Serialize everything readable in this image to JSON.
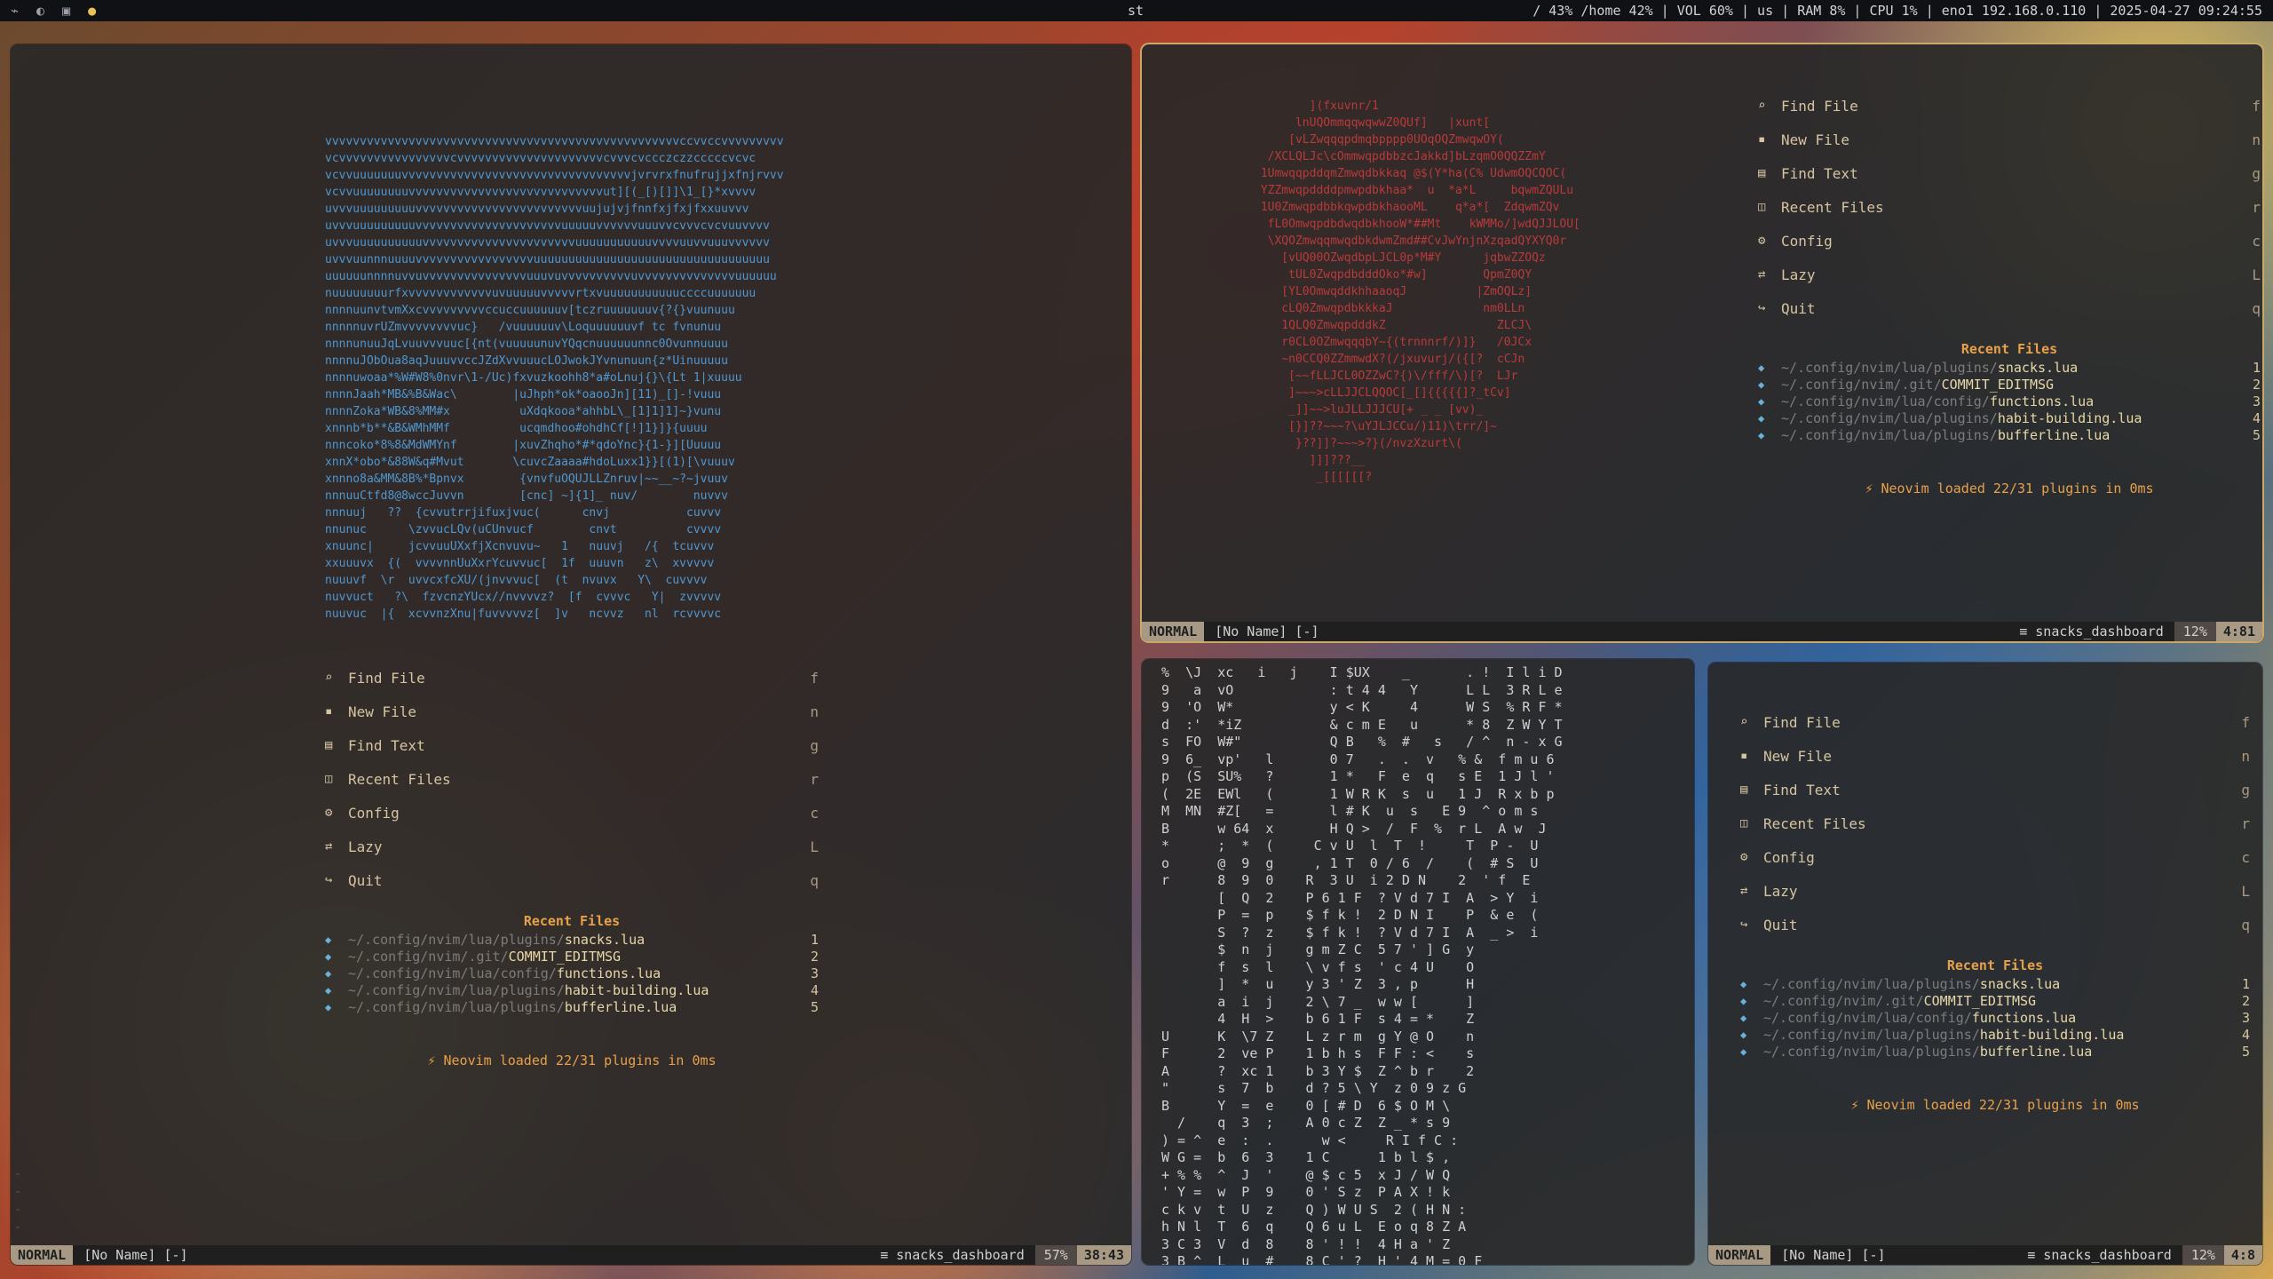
{
  "topbar": {
    "workspaces": [
      "⌁",
      "◐",
      "▣",
      "●"
    ],
    "window_title": "st",
    "status": "/ 43%  /home 42% | VOL 60% | us | RAM  8% | CPU  1% | eno1 192.168.0.110 | 2025-04-27 09:24:55"
  },
  "dashboard": {
    "menu": [
      {
        "icon": "search-icon",
        "glyph": "⌕",
        "label": "Find File",
        "key": "f"
      },
      {
        "icon": "new-file-icon",
        "glyph": "▪",
        "label": "New File",
        "key": "n"
      },
      {
        "icon": "text-icon",
        "glyph": "▤",
        "label": "Find Text",
        "key": "g"
      },
      {
        "icon": "recent-icon",
        "glyph": "◫",
        "label": "Recent Files",
        "key": "r"
      },
      {
        "icon": "gear-icon",
        "glyph": "⚙",
        "label": "Config",
        "key": "c"
      },
      {
        "icon": "lazy-icon",
        "glyph": "⇄",
        "label": "Lazy",
        "key": "L"
      },
      {
        "icon": "quit-icon",
        "glyph": "↪",
        "label": "Quit",
        "key": "q"
      }
    ],
    "recent_title": "Recent Files",
    "recent": [
      {
        "dir": "~/.config/nvim/lua/plugins/",
        "file": "snacks.lua",
        "num": "1"
      },
      {
        "dir": "~/.config/nvim/.git/",
        "file": "COMMIT_EDITMSG",
        "num": "2"
      },
      {
        "dir": "~/.config/nvim/lua/config/",
        "file": "functions.lua",
        "num": "3"
      },
      {
        "dir": "~/.config/nvim/lua/plugins/",
        "file": "habit-building.lua",
        "num": "4"
      },
      {
        "dir": "~/.config/nvim/lua/plugins/",
        "file": "bufferline.lua",
        "num": "5"
      }
    ],
    "loaded": "⚡ Neovim loaded 22/31 plugins in 0ms"
  },
  "panes": {
    "left": {
      "mode": "NORMAL",
      "name": "[No Name] [-]",
      "filetype": "≡ snacks_dashboard",
      "percent": "57%",
      "pos": "38:43"
    },
    "top_right": {
      "mode": "NORMAL",
      "name": "[No Name] [-]",
      "filetype": "≡ snacks_dashboard",
      "percent": "12%",
      "pos": "4:81"
    },
    "bottom_right": {
      "mode": "NORMAL",
      "name": "[No Name] [-]",
      "filetype": "≡ snacks_dashboard",
      "percent": "12%",
      "pos": "4:8"
    }
  },
  "art_left": "vvvvvvvvvvvvvvvvvvvvvvvvvvvvvvvvvvvvvvvvvvvvvvvvvvvccvvccvvvvvvvvv\nvcvvvvvvvvvvvvvvvvcvvvvvvvvvvvvvvvvvvvvvcvvvcvccczczzcccccvcvc\nvcvvuuuuuuuvvvvvvvvvvvvvvvvvvvvvvvvvvvvvvvvvjvrvrxfnufrujjxfnjrvvv\nvcvvuuuuuuuuvvvvvvvvvvvvvvvvvvvvvvvvvvvvut][(_[)[]]\\1_[}*xvvvv\nuvvvuuuuuuuuuvvvvvvvvvvvvvvvvvvvvvvvvuujujvjfnnfxjfxjfxxuuvvv\nuvvvuuuuuuuuuvvvvvvvvvvvvvvvvvvvvvuuuuuvvvvvvuuuvvcvvvcvcvuuvvvv\nuvvvuuuuuuuuuuvvvvvvvvvvvvvvvvvvvvvvuuuuuuuuuuuvvvvuuvvuuuvvvvvv\nuvvvuunnnuuuuvvvvvvvvvvvvvvvvvuuuuuuuuuuuuuuuuuuuuuuuuuuuuuuuuuu\nuuuuuunnnnuvvuvvvvvvvvvvvvvvvuuuvuvvvvvvvvvvuvvvvvvvvvvvvvvuuuuuu\nnuuuuuuuurfxvvvvvvvvvvvvuvuuuuuvvvvvrtxvuuuuuuuuuuuccccuuuuuuu\nnnnnuunvtvmXxcvvvvvvvvvccuccuuuuuuv[tczruuuuuuuv{?{}vuunuuu\nnnnnnuvrUZmvvvvvvvvuc}   /vuuuuuuv\\Loquuuuuuvf tc fvnunuu\nnnnnunuuJqLvuuvvvuuc[{nt(vuuuuunuvYQqcnuuuuuunnc0Ovunnuuuu\nnnnnuJObOua8aqJuuuvvccJZdXvvuuucLOJwokJYvnunuun{z*Uinuuuuu\nnnnnuwoaa*%W#W8%0nvr\\1-/Uc)fxvuzkoohh8*a#oLnuj{}\\{Lt 1|xuuuu\nnnnnJaah*MB&%B&Wac\\        |uJhph*ok*oaooJn][11)_[]-!vuuu\nnnnnZoka*WB&8%MM#x          uXdqkooa*ahhbL\\_[1]1]1]~}vunu\nxnnnb*b**&B&WMhMMf          ucqmdhoo#ohdhCf[!]1}]}{uuuu\nnnncoko*8%8&MdWMYnf        |xuvZhqho*#*qdoYnc}{1-}][Uuuuu\nxnnX*obo*&88W&q#Mvut       \\cuvcZaaaa#hdoLuxx1}}[(1)[\\vuuuv\nxnnno8a&MM&8B%*Bpnvx        {vnvfuOQUJLLZnruv|~~__~?~jvuuv\nnnnuuCtfd8@8wccJuvvn        [cnc] ~]{1]_ nuv/        nuvvv\nnnnuuj   ??  {cvvutrrjifuxjvuc(      cnvj           cuvvv\nnnunuc      \\zvvucLQv(uCUnvucf        cnvt          cvvvv\nxnuunc|     jcvvuuUXxfjXcnvuvu~   1   nuuvj   /{  tcuvvv\nxxuuuvx  {(  vvvvnnUuXxrYcuvvuc[  1f  uuuvn   z\\  xvvvvv\nnuuuvf  \\r  uvvcxfcXU/(jnvvvuc[  (t  nvuvx   Y\\  cuvvvv\nnuvvuct   ?\\  fzvcnzYUcx//nvvvvz?  [f  cvvvc   Y|  zvvvvv\nnuuvuc  |{  xcvvnzXnu|fuvvvvvz[  ]v   ncvvz   nl  rcvvvvc",
  "art_top_right": "        ](fxuvnr/1\n      lnUQOmmqqwqwwZ0QUf]   |xunt[\n     [vLZwqqqpdmqbpppp0UOqOQZmwqwOY(\n  /XCLQLJc\\cOmmwqpdbbzcJakkd]bLzqmO0QQZZmY\n 1UmwqqpddqmZmwqdbkkaq @$(Y*ha(C% UdwmOQCQOC(\n YZZmwqpddddpmwpdbkhaa*  u  *a*L     bqwmZQULu\n 1U0ZmwqpdbbkqwpdbkhaooML    q*a*[  ZdqwmZQv\n  fL0OmwqpdbdwqdbkhooW*##Mt    kWMMo/]wdQJJLOU[\n  \\XQOZmwqqmwqdbkdwmZmd##CvJwYnjnXzqadQYXYQ0r\n    [vUQ00OZwqdbpLJCL0p*M#Y      jqbwZZOQz\n     tUL0ZwqpdbdddOko*#w]        QpmZ0QY\n    [YL0OmwqddkhhaaoqJ          |ZmOQLz]\n    cLQ0ZmwqpdbkkkaJ             nm0LLn\n    1QLQ0ZmwqpdddkZ                ZLCJ\\\n    r0CL0OZmwqqqbY~{(trnnnrf/)]}   /0JCx\n    ~n0CCQ0ZZmmwdX?(/jxuvurj/({[?  cCJn\n     [~~fLLJCL0OZZwC?{)\\/fff/\\)[?  LJr\n     ]~~~>cLLJJCLQQOC[_[]{{{{{]?_tCv]\n     _]]~~>luJLLJJJCU[+ _ _ [vv)_\n     [}]??~~~?\\uYJLJCCu/)11)\\trr/]~\n      }??]]?~~~>?}(/nvzXzurt\\(\n        ]]]???__\n         _[[[[[[?",
  "matrix": "%  \\J  xc   i   j    I $UX    _       . !  I l i D\n9   a  vO            : t 4 4   Y      L L  3 R L e\n9  'O  W*            y < K     4      W S  % R F *\nd  :'  *iZ           & c m E   u      * 8  Z W Y T\ns  FO  W#\"           Q B   %  #   s   / ^  n - x G\n9  6_  vp'   l       0 7   .  .  v   % &  f m u 6\np  (S  SU%   ?       1 *   F  e  q   s E  1 J l '\n(  2E  EWl   (       1 W R K  s  u   1 J  R x b p\nM  MN  #Z[   =       l # K  u  s   E 9  ^ o m s\nB      w 64  x       H Q >  /  F  %  r L  A w  J\n*      ;  *  (     C v U  l  T  !     T  P -  U\no      @  9  g     , 1 T  0 / 6  /    (  # S  U\nr      8  9  0    R  3 U  i 2 D N    2  ' f  E\n       [  Q  2    P 6 1 F  ? V d 7 I  A  > Y  i\n       P  =  p    $ f k !  2 D N I    P  & e  (\n       S  ?  z    $ f k !  ? V d 7 I  A  _ >  i\n       $  n  j    g m Z C  5 7 ' ] G  y\n       f  s  l    \\ v f s  ' c 4 U    O\n       ]  *  u    y 3 ' Z  3 , p      H\n       a  i  j    2 \\ 7 _  w w [      ]\n       4  H  >    b 6 1 F  s 4 = *    Z\nU      K  \\7 Z    L z r m  g Y @ O    n\nF      2  ve P    1 b h s  F F : <    s\nA      ?  xc 1    b 3 Y $  Z ^ b r    2\n\"      s  7  b    d ? 5 \\ Y  z 0 9 z G\nB      Y  =  e    0 [ # D  6 $ O M \\\n  /    q  3  ;    A 0 c Z  Z _ * s 9\n) = ^  e  :  .      w <     R I f C :\nW G =  b  6  3    1 C      1 b l $ ,\n+ % %  ^  J  '    @ $ c 5  x J / W Q\n' Y =  w  P  9    0 ' S z  P A X ! k\nc k v  t  U  z    Q ) W U S  2 ( H N :\nh N l  T  6  q    Q 6 u L  E o q 8 Z A\n3 C 3  V  d  8    8 ' ! !  4 H a ' Z\n3 B ^  L  u  #    8 C ' ?  H ' 4 M = 0 F _"
}
